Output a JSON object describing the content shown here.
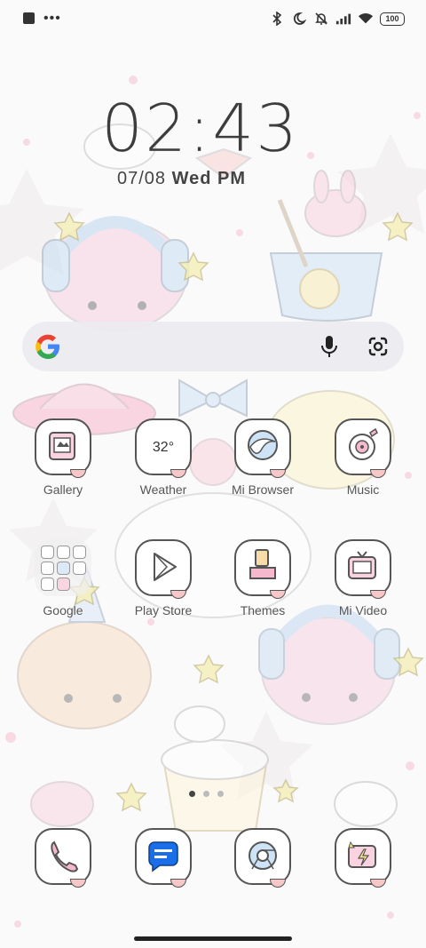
{
  "status_bar": {
    "left_icons": [
      "notification-square-icon",
      "more-dots-icon"
    ],
    "right_icons": [
      "bluetooth-icon",
      "do-not-disturb-icon",
      "notifications-muted-icon",
      "signal-icon",
      "wifi-icon"
    ],
    "battery": "100"
  },
  "clock": {
    "time": "02:43",
    "date": "07/08",
    "weekday": "Wed",
    "ampm": "PM"
  },
  "search": {
    "google_icon": "google-logo-icon",
    "mic_icon": "mic-icon",
    "lens_icon": "google-lens-icon"
  },
  "apps_row1": [
    {
      "label": "Gallery",
      "icon": "gallery-icon"
    },
    {
      "label": "Weather",
      "icon": "weather-icon",
      "icon_text": "32°"
    },
    {
      "label": "Mi Browser",
      "icon": "browser-icon"
    },
    {
      "label": "Music",
      "icon": "music-icon"
    }
  ],
  "apps_row2": [
    {
      "label": "Google",
      "icon": "google-folder-icon"
    },
    {
      "label": "Play Store",
      "icon": "play-store-icon"
    },
    {
      "label": "Themes",
      "icon": "themes-icon"
    },
    {
      "label": "Mi Video",
      "icon": "mi-video-icon"
    }
  ],
  "dock": [
    {
      "icon": "phone-icon"
    },
    {
      "icon": "messages-icon"
    },
    {
      "icon": "chrome-icon"
    },
    {
      "icon": "security-icon"
    }
  ],
  "page_indicator": {
    "pages": 3,
    "current": 1
  }
}
